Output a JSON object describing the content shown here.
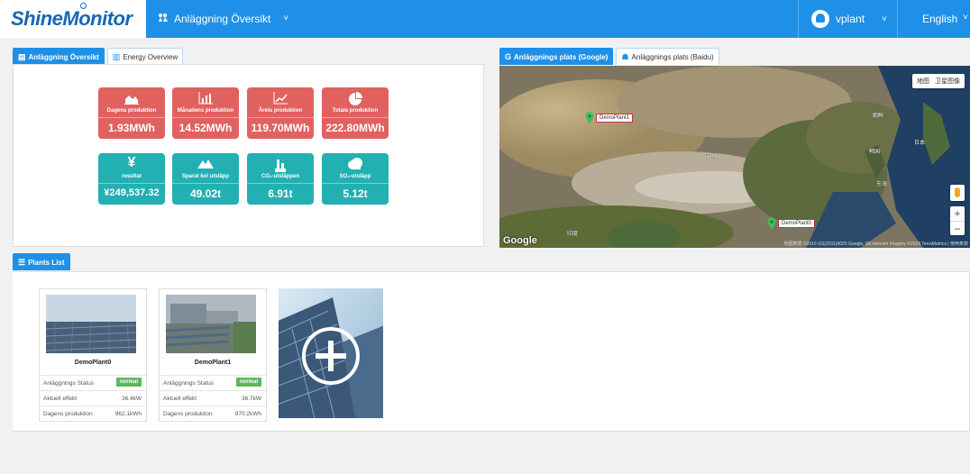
{
  "app": {
    "logo": "ShineMonitor"
  },
  "nav": {
    "item_label": "Anläggning Översikt"
  },
  "user": {
    "name": "vplant",
    "language": "English"
  },
  "overview": {
    "tabs": [
      "Anläggning Översikt",
      "Energy Overview"
    ],
    "stats": [
      {
        "label": "Dagens produktion",
        "value": "1.93MWh",
        "icon": "area-chart-icon",
        "color": "#e1615f"
      },
      {
        "label": "Månadens produktion",
        "value": "14.52MWh",
        "icon": "bar-chart-icon",
        "color": "#e1615f"
      },
      {
        "label": "Årets produktion",
        "value": "119.70MWh",
        "icon": "line-chart-icon",
        "color": "#e1615f"
      },
      {
        "label": "Totala produktion",
        "value": "222.80MWh",
        "icon": "pie-chart-icon",
        "color": "#e1615f"
      },
      {
        "label": "resultat",
        "value": "¥249,537.32",
        "icon": "yen-icon",
        "color": "#22b0b3"
      },
      {
        "label": "Sparat kol utsläpp",
        "value": "49.02t",
        "icon": "mountain-icon",
        "color": "#22b0b3"
      },
      {
        "label": "CO₂-utsläppen",
        "value": "6.91t",
        "icon": "factory-icon",
        "color": "#22b0b3"
      },
      {
        "label": "SO₂-utsläpp",
        "value": "5.12t",
        "icon": "cloud-icon",
        "color": "#22b0b3"
      }
    ]
  },
  "map": {
    "tabs": [
      "Anläggnings plats (Google)",
      "Anläggnings plats (Baidu)"
    ],
    "controls": [
      "地图",
      "卫星图像"
    ],
    "markers": [
      "DemoPlant1",
      "DemoPlant0"
    ],
    "places": [
      "中国",
      "韩国",
      "日本",
      "印度",
      "朝鲜",
      "东海"
    ],
    "google_logo": "Google",
    "attribution": "地图数据 ©2016 GS(2011)6020 Google, SK telecom Imagery ©2016 TerraMetrics | 使用条款"
  },
  "plants": {
    "tab_label": "Plants List",
    "items": [
      {
        "name": "DemoPlant0",
        "status_label": "Anläggnings Status",
        "status": "normal",
        "power_label": "Aktuell effekt",
        "power": "36.4kW",
        "today_label": "Dagens produktion",
        "today": "962.1kWh"
      },
      {
        "name": "DemoPlant1",
        "status_label": "Anläggnings Status",
        "status": "normal",
        "power_label": "Aktuell effekt",
        "power": "36.7kW",
        "today_label": "Dagens produktion",
        "today": "970.2kWh"
      }
    ]
  }
}
